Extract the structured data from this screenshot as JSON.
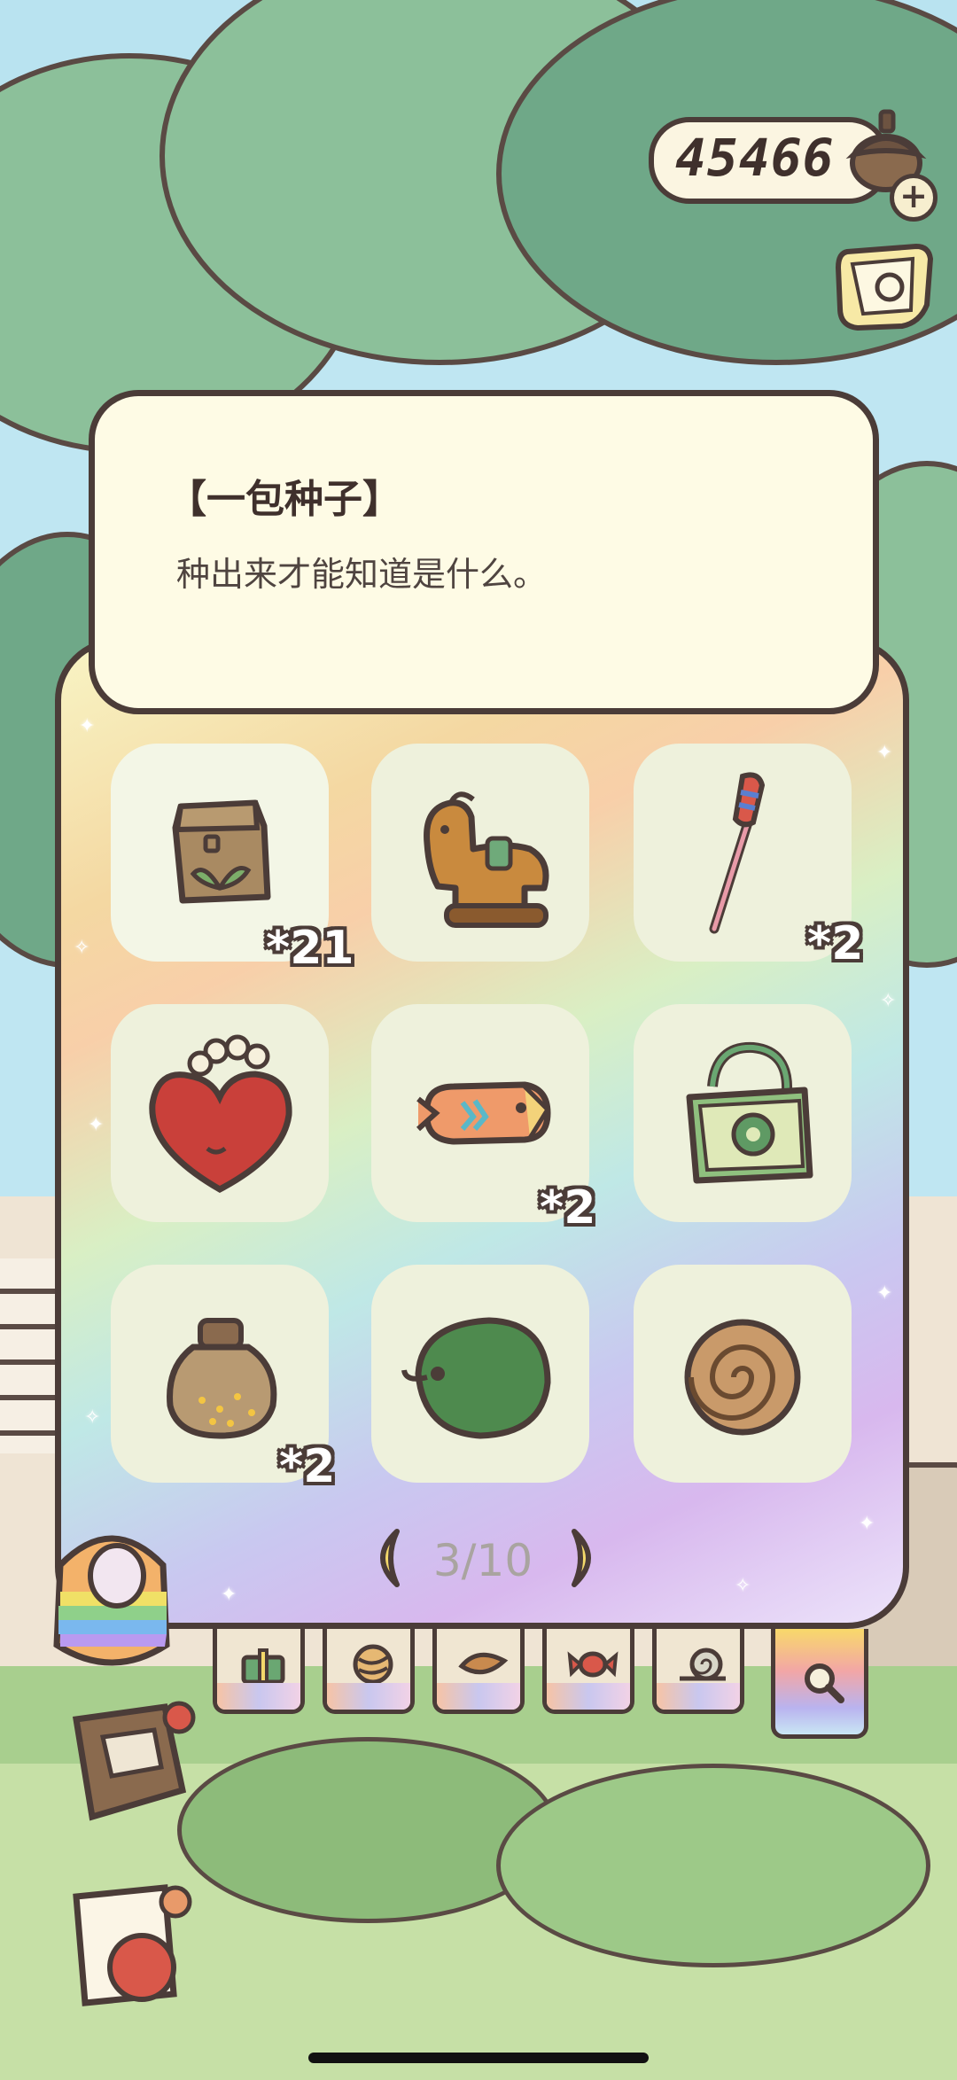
{
  "currency": {
    "amount": "45466",
    "icon": "acorn-icon",
    "add_icon": "plus-icon"
  },
  "side_icons": [
    "ticket-icon",
    "rainbow-bag-icon",
    "notebook-icon",
    "paper-icon"
  ],
  "info": {
    "title": "【一包种子】",
    "description": "种出来才能知道是什么。"
  },
  "items": [
    {
      "name": "seed-packet",
      "icon": "seed-packet-icon",
      "count": "*21",
      "selected": true
    },
    {
      "name": "toy-horse",
      "icon": "toy-horse-icon",
      "count": ""
    },
    {
      "name": "firework-stick",
      "icon": "firework-stick-icon",
      "count": "*2"
    },
    {
      "name": "heart-pouch",
      "icon": "heart-pouch-icon",
      "count": ""
    },
    {
      "name": "fish-snack",
      "icon": "fish-snack-icon",
      "count": "*2"
    },
    {
      "name": "green-bag",
      "icon": "tote-bag-icon",
      "count": ""
    },
    {
      "name": "honey-jar",
      "icon": "jar-icon",
      "count": "*2"
    },
    {
      "name": "green-cushion",
      "icon": "cushion-icon",
      "count": ""
    },
    {
      "name": "cinnamon-roll",
      "icon": "cinnamon-roll-icon",
      "count": ""
    }
  ],
  "pager": {
    "text": "3/10",
    "prev_icon": "chevron-left-icon",
    "next_icon": "chevron-right-icon"
  },
  "tabs": [
    {
      "name": "gift",
      "icon": "gift-icon"
    },
    {
      "name": "yarn",
      "icon": "yarn-icon"
    },
    {
      "name": "leaf",
      "icon": "leaf-icon"
    },
    {
      "name": "candy",
      "icon": "candy-icon"
    },
    {
      "name": "snail",
      "icon": "snail-icon"
    },
    {
      "name": "search",
      "icon": "search-icon",
      "active": true
    }
  ]
}
